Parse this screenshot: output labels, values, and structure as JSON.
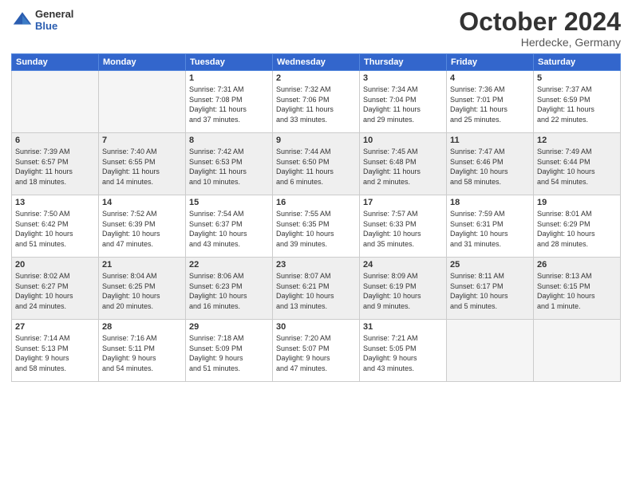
{
  "logo": {
    "general": "General",
    "blue": "Blue"
  },
  "header": {
    "month": "October 2024",
    "location": "Herdecke, Germany"
  },
  "weekdays": [
    "Sunday",
    "Monday",
    "Tuesday",
    "Wednesday",
    "Thursday",
    "Friday",
    "Saturday"
  ],
  "weeks": [
    [
      {
        "day": "",
        "detail": ""
      },
      {
        "day": "",
        "detail": ""
      },
      {
        "day": "1",
        "detail": "Sunrise: 7:31 AM\nSunset: 7:08 PM\nDaylight: 11 hours\nand 37 minutes."
      },
      {
        "day": "2",
        "detail": "Sunrise: 7:32 AM\nSunset: 7:06 PM\nDaylight: 11 hours\nand 33 minutes."
      },
      {
        "day": "3",
        "detail": "Sunrise: 7:34 AM\nSunset: 7:04 PM\nDaylight: 11 hours\nand 29 minutes."
      },
      {
        "day": "4",
        "detail": "Sunrise: 7:36 AM\nSunset: 7:01 PM\nDaylight: 11 hours\nand 25 minutes."
      },
      {
        "day": "5",
        "detail": "Sunrise: 7:37 AM\nSunset: 6:59 PM\nDaylight: 11 hours\nand 22 minutes."
      }
    ],
    [
      {
        "day": "6",
        "detail": "Sunrise: 7:39 AM\nSunset: 6:57 PM\nDaylight: 11 hours\nand 18 minutes."
      },
      {
        "day": "7",
        "detail": "Sunrise: 7:40 AM\nSunset: 6:55 PM\nDaylight: 11 hours\nand 14 minutes."
      },
      {
        "day": "8",
        "detail": "Sunrise: 7:42 AM\nSunset: 6:53 PM\nDaylight: 11 hours\nand 10 minutes."
      },
      {
        "day": "9",
        "detail": "Sunrise: 7:44 AM\nSunset: 6:50 PM\nDaylight: 11 hours\nand 6 minutes."
      },
      {
        "day": "10",
        "detail": "Sunrise: 7:45 AM\nSunset: 6:48 PM\nDaylight: 11 hours\nand 2 minutes."
      },
      {
        "day": "11",
        "detail": "Sunrise: 7:47 AM\nSunset: 6:46 PM\nDaylight: 10 hours\nand 58 minutes."
      },
      {
        "day": "12",
        "detail": "Sunrise: 7:49 AM\nSunset: 6:44 PM\nDaylight: 10 hours\nand 54 minutes."
      }
    ],
    [
      {
        "day": "13",
        "detail": "Sunrise: 7:50 AM\nSunset: 6:42 PM\nDaylight: 10 hours\nand 51 minutes."
      },
      {
        "day": "14",
        "detail": "Sunrise: 7:52 AM\nSunset: 6:39 PM\nDaylight: 10 hours\nand 47 minutes."
      },
      {
        "day": "15",
        "detail": "Sunrise: 7:54 AM\nSunset: 6:37 PM\nDaylight: 10 hours\nand 43 minutes."
      },
      {
        "day": "16",
        "detail": "Sunrise: 7:55 AM\nSunset: 6:35 PM\nDaylight: 10 hours\nand 39 minutes."
      },
      {
        "day": "17",
        "detail": "Sunrise: 7:57 AM\nSunset: 6:33 PM\nDaylight: 10 hours\nand 35 minutes."
      },
      {
        "day": "18",
        "detail": "Sunrise: 7:59 AM\nSunset: 6:31 PM\nDaylight: 10 hours\nand 31 minutes."
      },
      {
        "day": "19",
        "detail": "Sunrise: 8:01 AM\nSunset: 6:29 PM\nDaylight: 10 hours\nand 28 minutes."
      }
    ],
    [
      {
        "day": "20",
        "detail": "Sunrise: 8:02 AM\nSunset: 6:27 PM\nDaylight: 10 hours\nand 24 minutes."
      },
      {
        "day": "21",
        "detail": "Sunrise: 8:04 AM\nSunset: 6:25 PM\nDaylight: 10 hours\nand 20 minutes."
      },
      {
        "day": "22",
        "detail": "Sunrise: 8:06 AM\nSunset: 6:23 PM\nDaylight: 10 hours\nand 16 minutes."
      },
      {
        "day": "23",
        "detail": "Sunrise: 8:07 AM\nSunset: 6:21 PM\nDaylight: 10 hours\nand 13 minutes."
      },
      {
        "day": "24",
        "detail": "Sunrise: 8:09 AM\nSunset: 6:19 PM\nDaylight: 10 hours\nand 9 minutes."
      },
      {
        "day": "25",
        "detail": "Sunrise: 8:11 AM\nSunset: 6:17 PM\nDaylight: 10 hours\nand 5 minutes."
      },
      {
        "day": "26",
        "detail": "Sunrise: 8:13 AM\nSunset: 6:15 PM\nDaylight: 10 hours\nand 1 minute."
      }
    ],
    [
      {
        "day": "27",
        "detail": "Sunrise: 7:14 AM\nSunset: 5:13 PM\nDaylight: 9 hours\nand 58 minutes."
      },
      {
        "day": "28",
        "detail": "Sunrise: 7:16 AM\nSunset: 5:11 PM\nDaylight: 9 hours\nand 54 minutes."
      },
      {
        "day": "29",
        "detail": "Sunrise: 7:18 AM\nSunset: 5:09 PM\nDaylight: 9 hours\nand 51 minutes."
      },
      {
        "day": "30",
        "detail": "Sunrise: 7:20 AM\nSunset: 5:07 PM\nDaylight: 9 hours\nand 47 minutes."
      },
      {
        "day": "31",
        "detail": "Sunrise: 7:21 AM\nSunset: 5:05 PM\nDaylight: 9 hours\nand 43 minutes."
      },
      {
        "day": "",
        "detail": ""
      },
      {
        "day": "",
        "detail": ""
      }
    ]
  ]
}
